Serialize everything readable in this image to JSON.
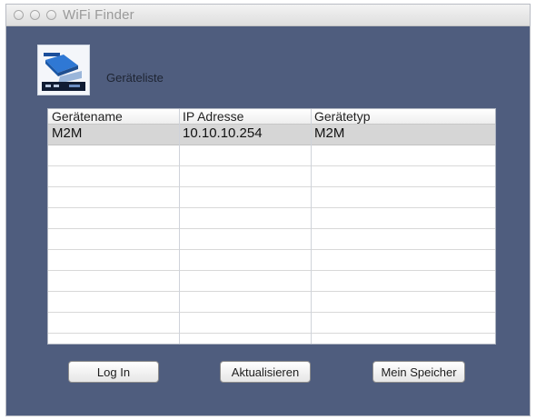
{
  "window": {
    "title": "WiFi Finder"
  },
  "header": {
    "label": "Geräteliste",
    "logo_icon": "wifi-router-icon"
  },
  "table": {
    "columns": [
      "Gerätename",
      "IP Adresse",
      "Gerätetyp"
    ],
    "rows": [
      {
        "name": "M2M",
        "ip": "10.10.10.254",
        "type": "M2M"
      }
    ]
  },
  "buttons": {
    "login": "Log In",
    "refresh": "Aktualisieren",
    "storage": "Mein Speicher"
  },
  "colors": {
    "window_background": "#4f5d7e",
    "selected_row": "#d6d6d6"
  }
}
